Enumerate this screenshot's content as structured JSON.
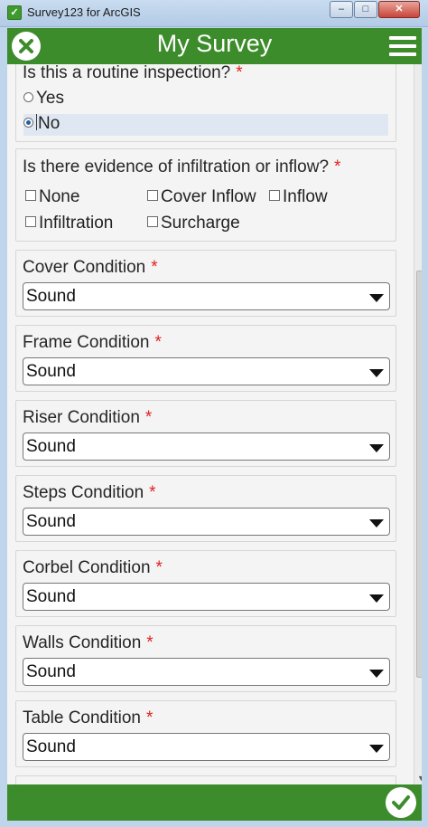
{
  "window": {
    "title": "Survey123 for ArcGIS",
    "minimize": "–",
    "maximize": "□",
    "close": "✕"
  },
  "header": {
    "title": "My Survey"
  },
  "questions": {
    "routine": {
      "label": "Is this a routine inspection?",
      "required": "*",
      "options": [
        "Yes",
        "No"
      ],
      "selected": "No"
    },
    "infiltration": {
      "label": "Is there evidence of infiltration or inflow?",
      "required": "*",
      "options": [
        "None",
        "Cover Inflow",
        "Inflow",
        "Infiltration",
        "Surcharge"
      ]
    },
    "selects": [
      {
        "label": "Cover Condition",
        "required": "*",
        "value": "Sound"
      },
      {
        "label": "Frame Condition",
        "required": "*",
        "value": "Sound"
      },
      {
        "label": "Riser Condition",
        "required": "*",
        "value": "Sound"
      },
      {
        "label": "Steps Condition",
        "required": "*",
        "value": "Sound"
      },
      {
        "label": "Corbel Condition",
        "required": "*",
        "value": "Sound"
      },
      {
        "label": "Walls Condition",
        "required": "*",
        "value": "Sound"
      },
      {
        "label": "Table Condition",
        "required": "*",
        "value": "Sound"
      }
    ]
  },
  "colors": {
    "brand_green": "#3d8c2c",
    "required_red": "#e21f1f"
  }
}
